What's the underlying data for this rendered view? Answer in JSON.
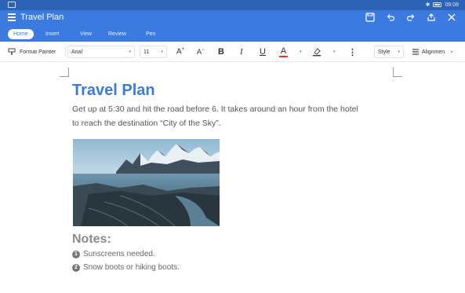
{
  "status": {
    "time": "08:08"
  },
  "title": {
    "text": "Travel Plan"
  },
  "tabs": [
    {
      "label": "Home",
      "active": true
    },
    {
      "label": "Insert"
    },
    {
      "label": "View"
    },
    {
      "label": "Review"
    },
    {
      "label": "Pen"
    }
  ],
  "toolbar": {
    "format_painter": "Format Painter",
    "font_name": "Arial",
    "font_size": "11",
    "bold": "B",
    "italic": "I",
    "underline": "U",
    "font_color_letter": "A",
    "style": "Style",
    "alignment": "Alignmen"
  },
  "document": {
    "heading": "Travel Plan",
    "paragraph_line1": "Get up at 5:30 and hit the road before 6. It takes around an hour from the hotel",
    "paragraph_line2": "to reach the destination “City of the Sky”.",
    "notes_title": "Notes:",
    "notes": [
      {
        "num": "1",
        "text": "Sunscreens needed."
      },
      {
        "num": "2",
        "text": "Snow boots or hiking boots."
      }
    ]
  },
  "colors": {
    "accent": "#3b7be0",
    "font_color": "#e53935"
  }
}
